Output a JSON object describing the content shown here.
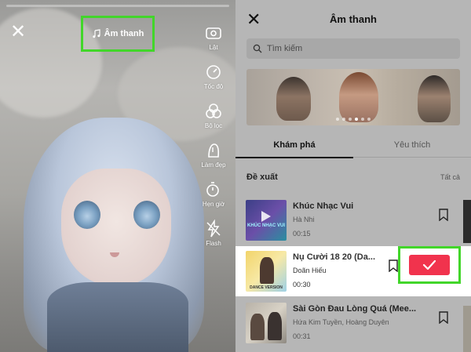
{
  "camera": {
    "sound_label": "Âm thanh",
    "tools": [
      {
        "icon": "flip-camera-icon",
        "label": "Lật"
      },
      {
        "icon": "speed-icon",
        "label": "Tốc độ"
      },
      {
        "icon": "filter-icon",
        "label": "Bộ lọc"
      },
      {
        "icon": "beauty-icon",
        "label": "Làm đẹp"
      },
      {
        "icon": "timer-icon",
        "label": "Hẹn giờ"
      },
      {
        "icon": "flash-icon",
        "label": "Flash"
      }
    ]
  },
  "sheet": {
    "title": "Âm thanh",
    "search_placeholder": "Tìm kiếm",
    "tabs": [
      {
        "label": "Khám phá",
        "active": true
      },
      {
        "label": "Yêu thích",
        "active": false
      }
    ],
    "section_title": "Đề xuất",
    "section_more": "Tất cả",
    "tracks": [
      {
        "title": "Khúc Nhạc Vui",
        "artist": "Hà Nhi",
        "duration": "00:15",
        "selected": false
      },
      {
        "title": "Nụ Cười 18 20 (Da...",
        "artist": "Doãn Hiếu",
        "duration": "00:30",
        "selected": true
      },
      {
        "title": "Sài Gòn Đau Lòng Quá (Mee...",
        "artist": "Hứa Kim Tuyền, Hoàng Duyên",
        "duration": "00:31",
        "selected": false
      }
    ],
    "cover_texts": {
      "track1": "KHÚC NHẠC VUI",
      "track2": "DANCE VERSION"
    }
  },
  "colors": {
    "highlight_green": "#42d62a",
    "confirm_red": "#f1334d"
  }
}
